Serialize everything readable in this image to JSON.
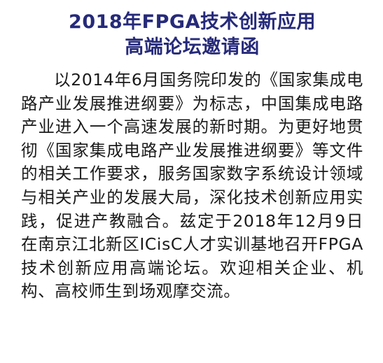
{
  "colors": {
    "title": "#262a7a",
    "body_text": "#1a1a1a",
    "background": "#ffffff"
  },
  "document": {
    "title_line_1": "2018年FPGA技术创新应用",
    "title_line_2": "高端论坛邀请函",
    "paragraph": "以2014年6月国务院印发的《国家集成电路产业发展推进纲要》为标志，中国集成电路产业进入一个高速发展的新时期。为更好地贯彻《国家集成电路产业发展推进纲要》等文件的相关工作要求，服务国家数字系统设计领域与相关产业的发展大局，深化技术创新应用实践，促进产教融合。兹定于2018年12月9日在南京江北新区ICisC人才实训基地召开FPGA技术创新应用高端论坛。欢迎相关企业、机构、高校师生到场观摩交流。"
  }
}
